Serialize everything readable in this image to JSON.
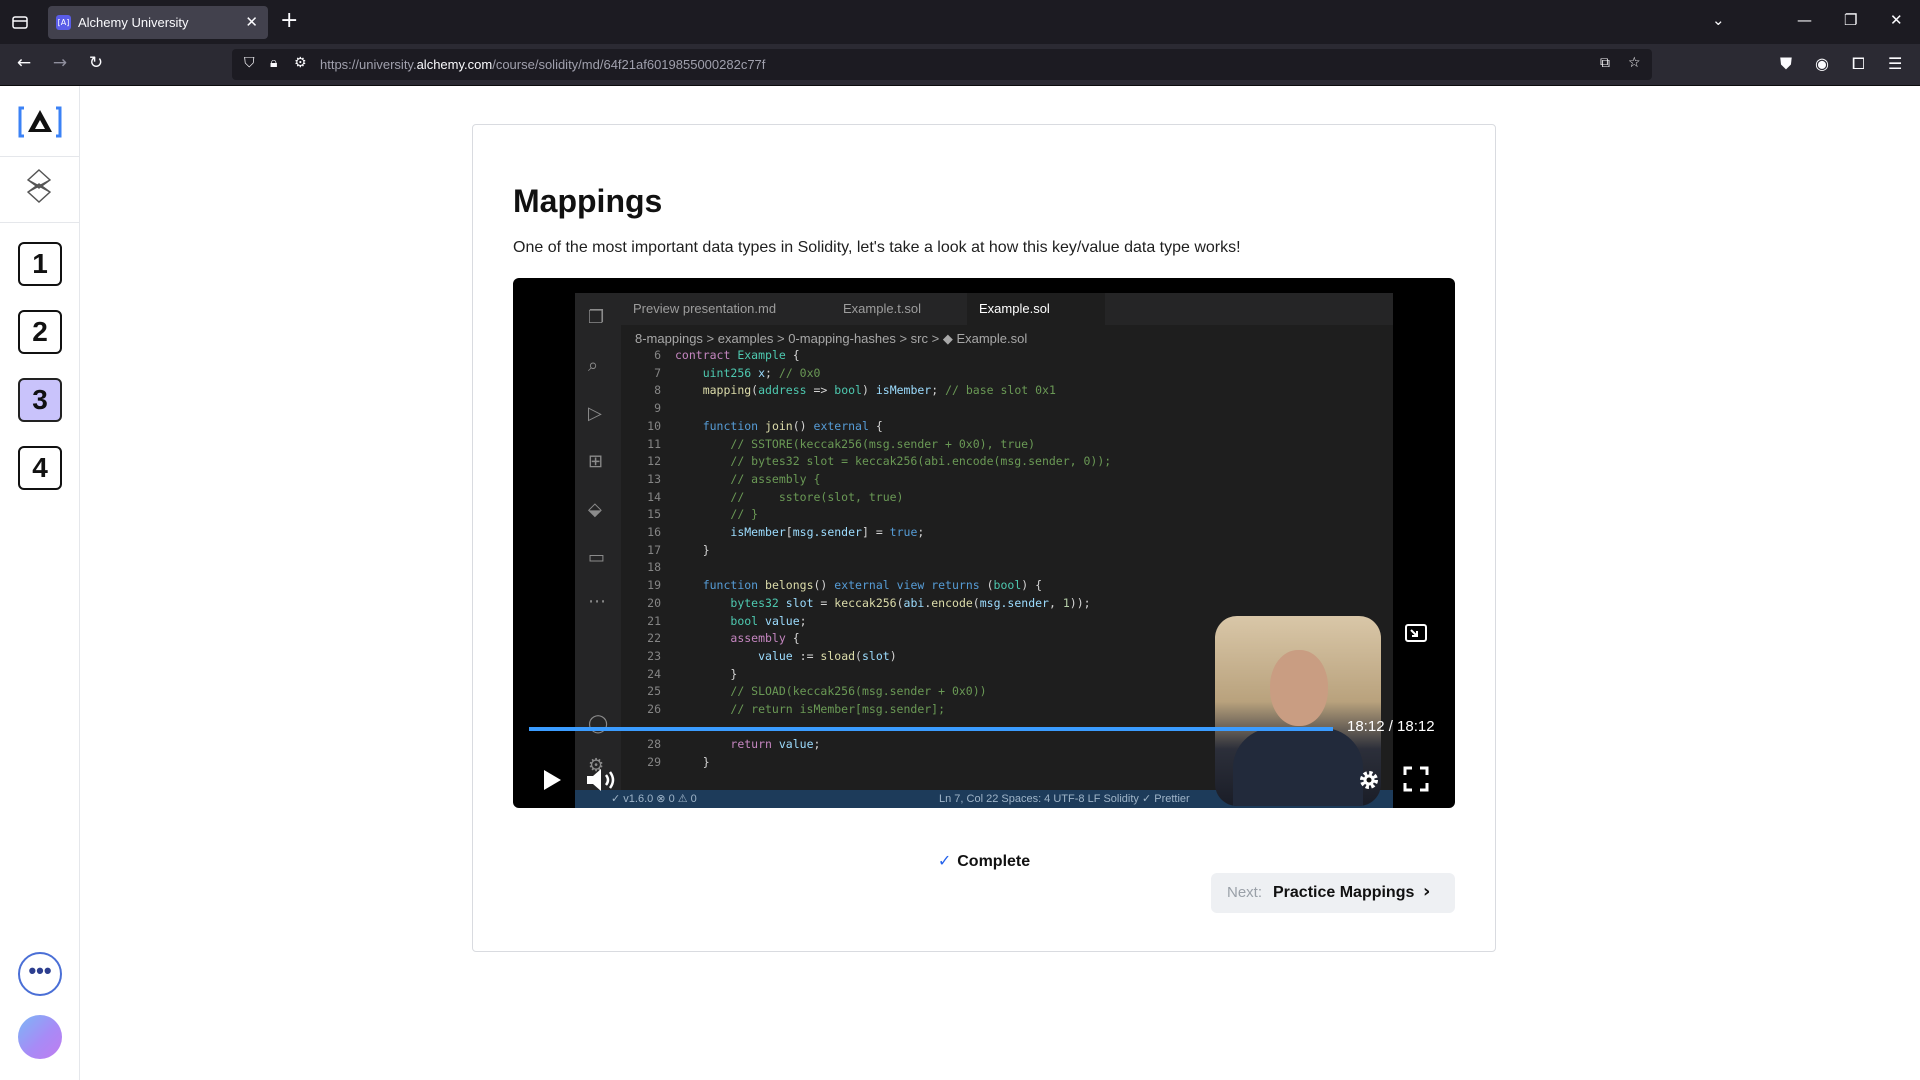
{
  "browser": {
    "tab_title": "Alchemy University",
    "favicon_text": "[A]",
    "url_prefix": "https://university.",
    "url_domain": "alchemy.com",
    "url_path": "/course/solidity/md/64f21af6019855000282c77f"
  },
  "sidebar": {
    "steps": [
      "1",
      "2",
      "3",
      "4"
    ],
    "active_step": "3",
    "more_label": "•••"
  },
  "lesson": {
    "title": "Mappings",
    "description": "One of the most important data types in Solidity, let's take a look at how this key/value data type works!"
  },
  "video": {
    "time": "18:12 / 18:12",
    "progress": 1.0,
    "editor_tabs": [
      "Preview presentation.md",
      "Example.t.sol",
      "Example.sol"
    ],
    "breadcrumbs": "8-mappings > examples > 0-mapping-hashes > src > ◆ Example.sol",
    "status_left": "✓ v1.6.0   ⊗ 0 ⚠ 0",
    "status_right": "Ln 7, Col 22    Spaces: 4    UTF-8    LF    Solidity    ✓ Prettier"
  },
  "actions": {
    "complete_label": "Complete",
    "next_prefix": "Next:",
    "next_label": "Practice Mappings"
  },
  "colors": {
    "accent": "#2563eb",
    "active_step": "#c9c3fb"
  }
}
